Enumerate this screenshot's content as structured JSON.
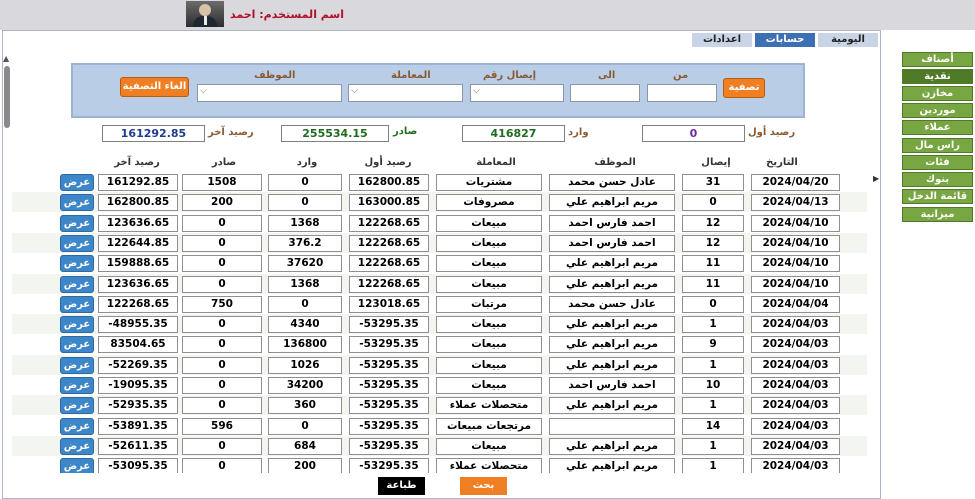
{
  "header": {
    "username_label": "اسم المستخدم: احمد"
  },
  "tabs": [
    {
      "label": "اليومية"
    },
    {
      "label": "حسابات"
    },
    {
      "label": "اعدادات"
    }
  ],
  "filter": {
    "filter_button": "تصفية",
    "clear_button": "الغاء التصفية",
    "from_label": "من",
    "to_label": "الى",
    "receipt_label": "إيصال رقم",
    "transaction_label": "المعاملة",
    "employee_label": "الموظف",
    "from_value": "",
    "to_value": "",
    "receipt_value": "",
    "transaction_value": "",
    "employee_value": ""
  },
  "balances": {
    "opening_label": "رصيد أول",
    "opening_value": "0",
    "incoming_label": "وارد",
    "incoming_value": "416827",
    "outgoing_label": "صادر",
    "outgoing_value": "255534.15",
    "closing_label": "رصيد آخر",
    "closing_value": "161292.85",
    "colors": {
      "opening": "#6a2aa0",
      "incoming": "#1f6b1f",
      "outgoing": "#1f6b1f",
      "closing": "#1f3b8f"
    }
  },
  "table": {
    "columns": [
      "التاريخ",
      "إيصال",
      "الموظف",
      "المعاملة",
      "رصيد أول",
      "وارد",
      "صادر",
      "رصيد آخر"
    ],
    "view_label": "عرض",
    "rows": [
      [
        "2024/04/20",
        "31",
        "عادل حسن محمد",
        "مشتريات",
        "162800.85",
        "0",
        "1508",
        "161292.85"
      ],
      [
        "2024/04/13",
        "0",
        "مريم ابراهيم علي",
        "مصروفات",
        "163000.85",
        "0",
        "200",
        "162800.85"
      ],
      [
        "2024/04/10",
        "12",
        "احمد فارس احمد",
        "مبيعات",
        "122268.65",
        "1368",
        "0",
        "123636.65"
      ],
      [
        "2024/04/10",
        "12",
        "احمد فارس احمد",
        "مبيعات",
        "122268.65",
        "376.2",
        "0",
        "122644.85"
      ],
      [
        "2024/04/10",
        "11",
        "مريم ابراهيم علي",
        "مبيعات",
        "122268.65",
        "37620",
        "0",
        "159888.65"
      ],
      [
        "2024/04/10",
        "11",
        "مريم ابراهيم علي",
        "مبيعات",
        "122268.65",
        "1368",
        "0",
        "123636.65"
      ],
      [
        "2024/04/04",
        "0",
        "عادل حسن محمد",
        "مرتبات",
        "123018.65",
        "0",
        "750",
        "122268.65"
      ],
      [
        "2024/04/03",
        "1",
        "مريم ابراهيم علي",
        "مبيعات",
        "-53295.35",
        "4340",
        "0",
        "-48955.35"
      ],
      [
        "2024/04/03",
        "9",
        "مريم ابراهيم علي",
        "مبيعات",
        "-53295.35",
        "136800",
        "0",
        "83504.65"
      ],
      [
        "2024/04/03",
        "1",
        "مريم ابراهيم علي",
        "مبيعات",
        "-53295.35",
        "1026",
        "0",
        "-52269.35"
      ],
      [
        "2024/04/03",
        "10",
        "احمد فارس احمد",
        "مبيعات",
        "-53295.35",
        "34200",
        "0",
        "-19095.35"
      ],
      [
        "2024/04/03",
        "1",
        "مريم ابراهيم علي",
        "متحصلات عملاء",
        "-53295.35",
        "360",
        "0",
        "-52935.35"
      ],
      [
        "2024/04/03",
        "14",
        "",
        "مرتجعات مبيعات",
        "-53295.35",
        "0",
        "596",
        "-53891.35"
      ],
      [
        "2024/04/03",
        "1",
        "مريم ابراهيم علي",
        "مبيعات",
        "-53295.35",
        "684",
        "0",
        "-52611.35"
      ],
      [
        "2024/04/03",
        "1",
        "مريم ابراهيم علي",
        "متحصلات عملاء",
        "-53295.35",
        "200",
        "0",
        "-53095.35"
      ]
    ]
  },
  "footer": {
    "print_button": "طباعة",
    "search_button": "بحث"
  },
  "sidebar": {
    "items": [
      {
        "label": "أصناف"
      },
      {
        "label": "نقدية"
      },
      {
        "label": "مخازن"
      },
      {
        "label": "موردين"
      },
      {
        "label": "عملاء"
      },
      {
        "label": "راس مال"
      },
      {
        "label": "فئات"
      },
      {
        "label": "بنوك"
      },
      {
        "label": "قائمة الدخل"
      },
      {
        "label": "ميزانية"
      }
    ],
    "active_index": 1
  }
}
